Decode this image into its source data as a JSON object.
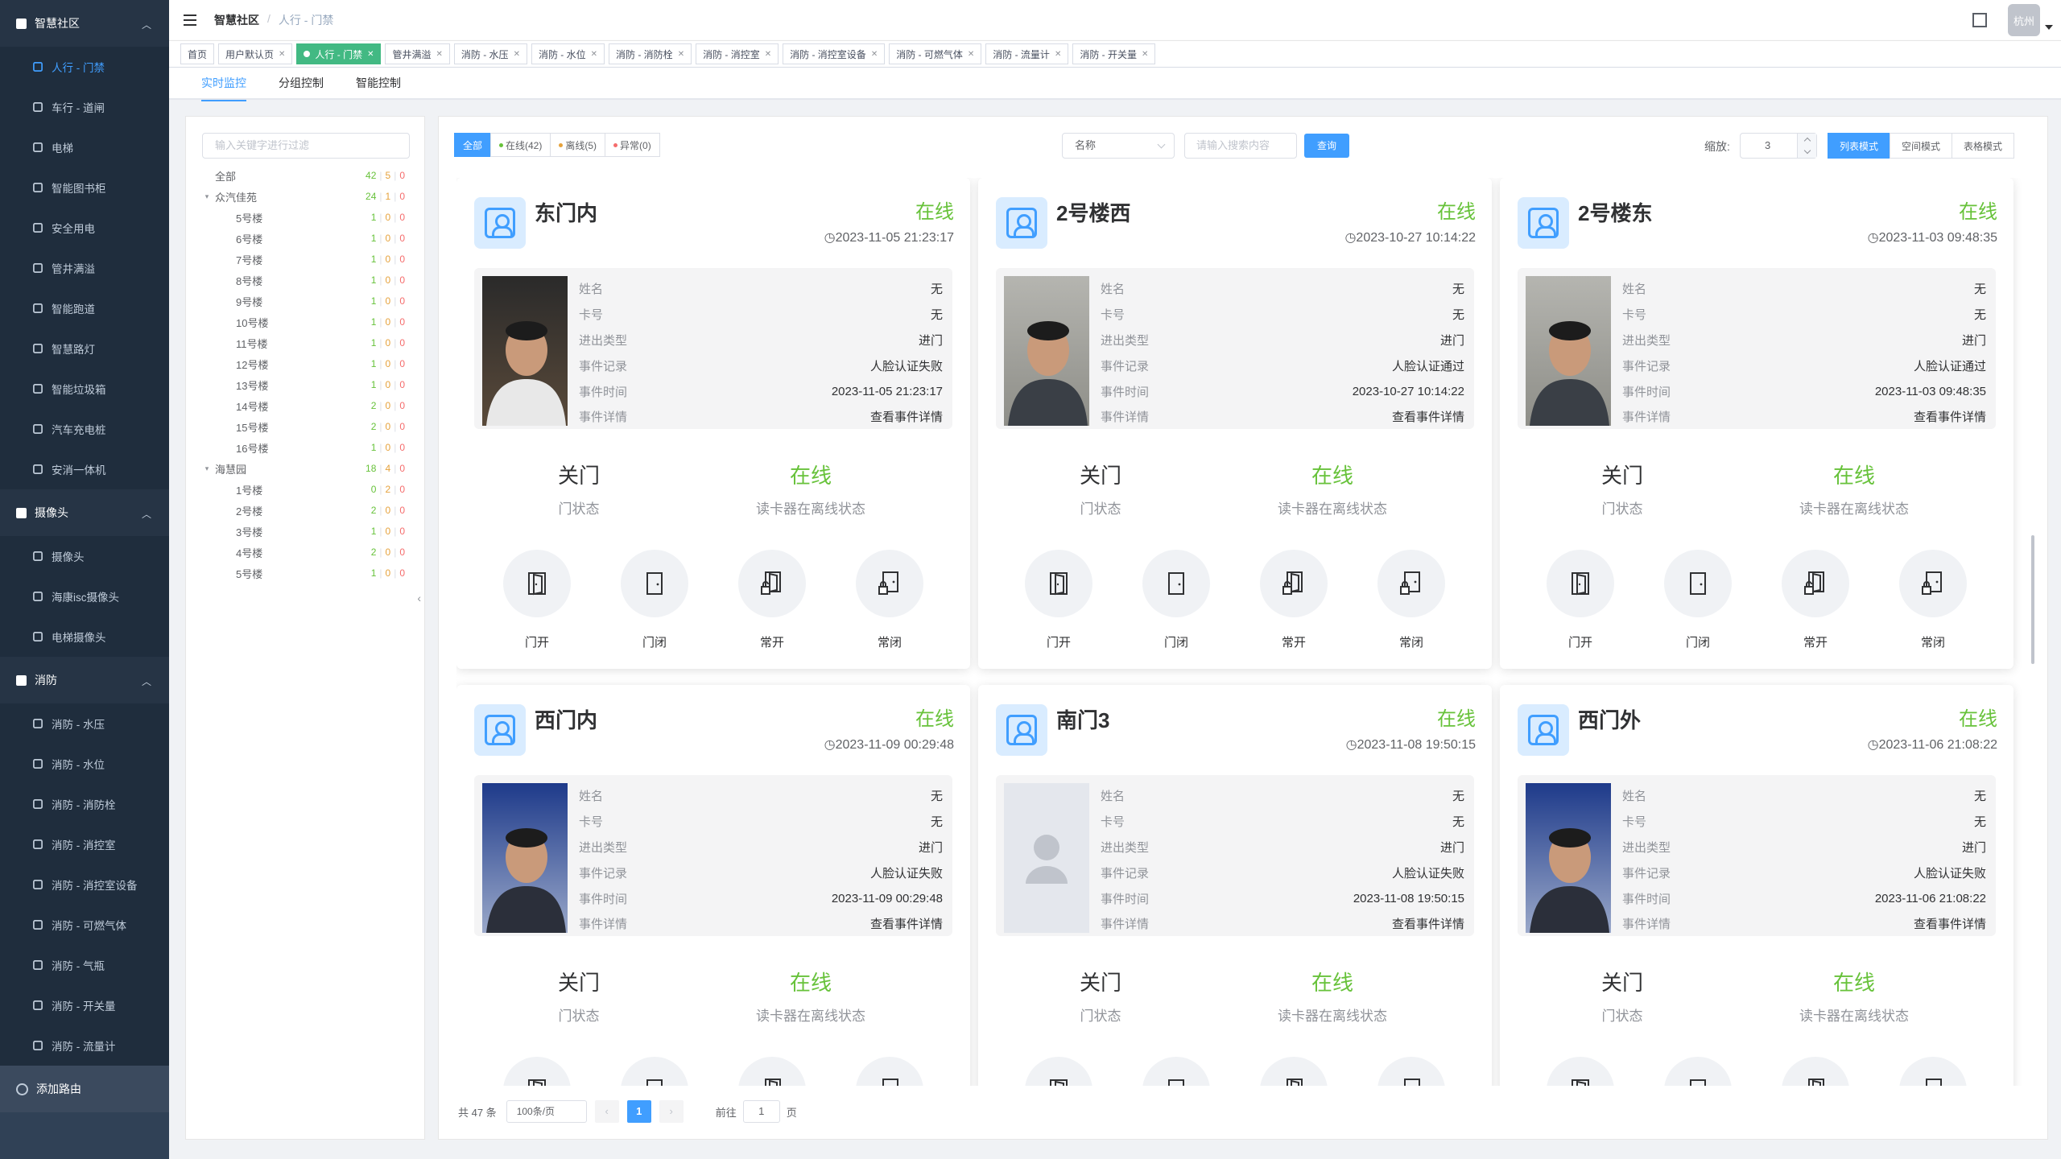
{
  "sidebar": {
    "groups": [
      {
        "label": "智慧社区",
        "items": [
          "人行 - 门禁",
          "车行 - 道闸",
          "电梯",
          "智能图书柜",
          "安全用电",
          "管井满溢",
          "智能跑道",
          "智慧路灯",
          "智能垃圾箱",
          "汽车充电桩",
          "安消一体机"
        ]
      },
      {
        "label": "摄像头",
        "items": [
          "摄像头",
          "海康isc摄像头",
          "电梯摄像头"
        ]
      },
      {
        "label": "消防",
        "items": [
          "消防 - 水压",
          "消防 - 水位",
          "消防 - 消防栓",
          "消防 - 消控室",
          "消防 - 消控室设备",
          "消防 - 可燃气体",
          "消防 - 气瓶",
          "消防 - 开关量",
          "消防 - 流量计"
        ]
      }
    ],
    "add_route": "添加路由",
    "active_color": "#409eff"
  },
  "navbar": {
    "breadcrumb1": "智慧社区",
    "breadcrumb2": "人行 - 门禁",
    "avatar_text": "杭州"
  },
  "tags": [
    {
      "label": "首页",
      "closable": false
    },
    {
      "label": "用户默认页",
      "closable": true
    },
    {
      "label": "人行 - 门禁",
      "closable": true,
      "active": true
    },
    {
      "label": "管井满溢",
      "closable": true
    },
    {
      "label": "消防 - 水压",
      "closable": true
    },
    {
      "label": "消防 - 水位",
      "closable": true
    },
    {
      "label": "消防 - 消防栓",
      "closable": true
    },
    {
      "label": "消防 - 消控室",
      "closable": true
    },
    {
      "label": "消防 - 消控室设备",
      "closable": true
    },
    {
      "label": "消防 - 可燃气体",
      "closable": true
    },
    {
      "label": "消防 - 流量计",
      "closable": true
    },
    {
      "label": "消防 - 开关量",
      "closable": true
    }
  ],
  "subtabs": [
    "实时监控",
    "分组控制",
    "智能控制"
  ],
  "tree": {
    "filter_placeholder": "输入关键字进行过滤",
    "rows": [
      {
        "label": "全部",
        "level": 0,
        "g": "42",
        "o": "5",
        "r": "0"
      },
      {
        "label": "众汽佳苑",
        "level": 0,
        "expand": true,
        "g": "24",
        "o": "1",
        "r": "0"
      },
      {
        "label": "5号楼",
        "level": 1,
        "g": "1",
        "o": "0",
        "r": "0"
      },
      {
        "label": "6号楼",
        "level": 1,
        "g": "1",
        "o": "0",
        "r": "0"
      },
      {
        "label": "7号楼",
        "level": 1,
        "g": "1",
        "o": "0",
        "r": "0"
      },
      {
        "label": "8号楼",
        "level": 1,
        "g": "1",
        "o": "0",
        "r": "0"
      },
      {
        "label": "9号楼",
        "level": 1,
        "g": "1",
        "o": "0",
        "r": "0"
      },
      {
        "label": "10号楼",
        "level": 1,
        "g": "1",
        "o": "0",
        "r": "0"
      },
      {
        "label": "11号楼",
        "level": 1,
        "g": "1",
        "o": "0",
        "r": "0"
      },
      {
        "label": "12号楼",
        "level": 1,
        "g": "1",
        "o": "0",
        "r": "0"
      },
      {
        "label": "13号楼",
        "level": 1,
        "g": "1",
        "o": "0",
        "r": "0"
      },
      {
        "label": "14号楼",
        "level": 1,
        "g": "2",
        "o": "0",
        "r": "0"
      },
      {
        "label": "15号楼",
        "level": 1,
        "g": "2",
        "o": "0",
        "r": "0"
      },
      {
        "label": "16号楼",
        "level": 1,
        "g": "1",
        "o": "0",
        "r": "0"
      },
      {
        "label": "海慧园",
        "level": 0,
        "expand": true,
        "g": "18",
        "o": "4",
        "r": "0"
      },
      {
        "label": "1号楼",
        "level": 1,
        "g": "0",
        "o": "2",
        "r": "0"
      },
      {
        "label": "2号楼",
        "level": 1,
        "g": "2",
        "o": "0",
        "r": "0"
      },
      {
        "label": "3号楼",
        "level": 1,
        "g": "1",
        "o": "0",
        "r": "0"
      },
      {
        "label": "4号楼",
        "level": 1,
        "g": "2",
        "o": "0",
        "r": "0"
      },
      {
        "label": "5号楼",
        "level": 1,
        "g": "1",
        "o": "0",
        "r": "0"
      }
    ]
  },
  "filters": {
    "buttons": [
      {
        "label": "全部",
        "active": true
      },
      {
        "label": "在线(42)",
        "dot": "#67c23a"
      },
      {
        "label": "离线(5)",
        "dot": "#e6a23c"
      },
      {
        "label": "异常(0)",
        "dot": "#f56c6c"
      }
    ],
    "select_value": "名称",
    "search_placeholder": "请输入搜索内容",
    "query_label": "查询",
    "zoom_label": "缩放:",
    "zoom_value": "3",
    "modes": [
      {
        "label": "列表模式",
        "active": true
      },
      {
        "label": "空间模式"
      },
      {
        "label": "表格模式"
      }
    ]
  },
  "info_keys": [
    "姓名",
    "卡号",
    "进出类型",
    "事件记录",
    "事件时间",
    "事件详情"
  ],
  "actions": [
    {
      "label": "门开",
      "icon": "door-open-icon"
    },
    {
      "label": "门闭",
      "icon": "door-closed-icon"
    },
    {
      "label": "常开",
      "icon": "door-always-open-icon"
    },
    {
      "label": "常闭",
      "icon": "door-always-closed-icon"
    }
  ],
  "door_state_label": "门状态",
  "reader_state_label": "读卡器在离线状态",
  "cards": [
    {
      "name": "东门内",
      "status": "在线",
      "time": "2023-11-05 21:23:17",
      "person": "无",
      "card": "无",
      "direction": "进门",
      "event": "人脸认证失败",
      "event_time": "2023-11-05 21:23:17",
      "detail": "查看事件详情",
      "door": "关门",
      "reader": "在线",
      "photo": "night"
    },
    {
      "name": "2号楼西",
      "status": "在线",
      "time": "2023-10-27 10:14:22",
      "person": "无",
      "card": "无",
      "direction": "进门",
      "event": "人脸认证通过",
      "event_time": "2023-10-27 10:14:22",
      "detail": "查看事件详情",
      "door": "关门",
      "reader": "在线",
      "photo": "indoor"
    },
    {
      "name": "2号楼东",
      "status": "在线",
      "time": "2023-11-03 09:48:35",
      "person": "无",
      "card": "无",
      "direction": "进门",
      "event": "人脸认证通过",
      "event_time": "2023-11-03 09:48:35",
      "detail": "查看事件详情",
      "door": "关门",
      "reader": "在线",
      "photo": "indoor"
    },
    {
      "name": "西门内",
      "status": "在线",
      "time": "2023-11-09 00:29:48",
      "person": "无",
      "card": "无",
      "direction": "进门",
      "event": "人脸认证失败",
      "event_time": "2023-11-09 00:29:48",
      "detail": "查看事件详情",
      "door": "关门",
      "reader": "在线",
      "photo": "blue"
    },
    {
      "name": "南门3",
      "status": "在线",
      "time": "2023-11-08 19:50:15",
      "person": "无",
      "card": "无",
      "direction": "进门",
      "event": "人脸认证失败",
      "event_time": "2023-11-08 19:50:15",
      "detail": "查看事件详情",
      "door": "关门",
      "reader": "在线",
      "photo": "placeholder"
    },
    {
      "name": "西门外",
      "status": "在线",
      "time": "2023-11-06 21:08:22",
      "person": "无",
      "card": "无",
      "direction": "进门",
      "event": "人脸认证失败",
      "event_time": "2023-11-06 21:08:22",
      "detail": "查看事件详情",
      "door": "关门",
      "reader": "在线",
      "photo": "blue"
    }
  ],
  "pagination": {
    "total": "共 47 条",
    "page_size": "100条/页",
    "current": "1",
    "goto_label": "前往",
    "goto_value": "1",
    "page_suffix": "页"
  }
}
